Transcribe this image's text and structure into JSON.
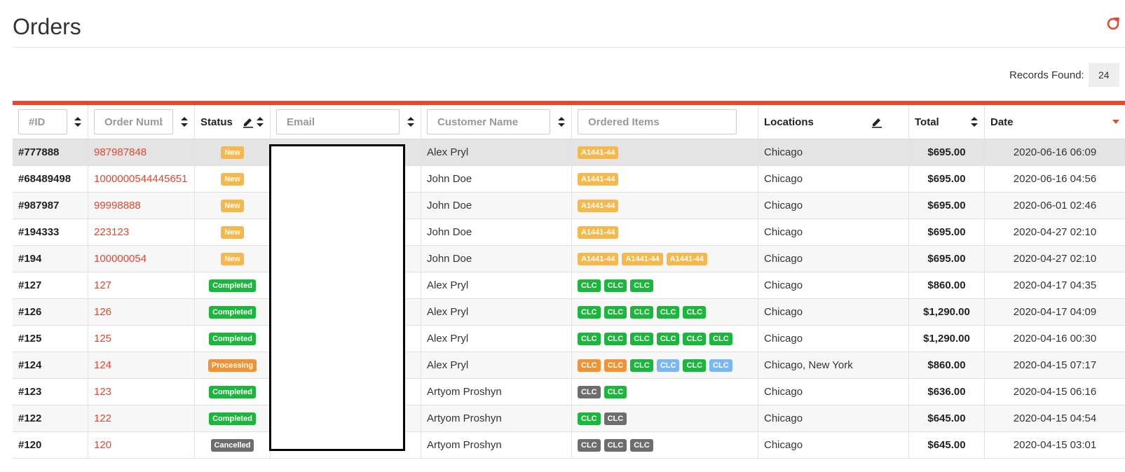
{
  "page": {
    "title": "Orders"
  },
  "toolbar": {
    "refresh_icon": "refresh-icon"
  },
  "records": {
    "label": "Records Found:",
    "count": "24"
  },
  "header": {
    "id_placeholder": "#ID",
    "order_number_placeholder": "Order Number",
    "status_label": "Status",
    "email_placeholder": "Email",
    "customer_name_placeholder": "Customer Name",
    "ordered_items_placeholder": "Ordered Items",
    "locations_label": "Locations",
    "total_label": "Total",
    "date_label": "Date"
  },
  "colors": {
    "accent": "#e5472f",
    "status_new": "#f7b84b",
    "status_completed": "#19b83a",
    "status_processing": "#f39232",
    "status_cancelled": "#6d6d6d",
    "item_blue": "#7ab8f5"
  },
  "orders": [
    {
      "id": "#777888",
      "number": "987987848",
      "status": "New",
      "status_class": "s-new",
      "customer": "Alex Pryl",
      "items": [
        {
          "label": "A1441-44",
          "color": "i-yellow"
        }
      ],
      "location": "Chicago",
      "total": "$695.00",
      "date": "2020-06-16 06:09",
      "selected": true
    },
    {
      "id": "#68489498",
      "number": "1000000544445651",
      "status": "New",
      "status_class": "s-new",
      "customer": "John Doe",
      "items": [
        {
          "label": "A1441-44",
          "color": "i-yellow"
        }
      ],
      "location": "Chicago",
      "total": "$695.00",
      "date": "2020-06-16 04:56"
    },
    {
      "id": "#987987",
      "number": "99998888",
      "status": "New",
      "status_class": "s-new",
      "customer": "John Doe",
      "items": [
        {
          "label": "A1441-44",
          "color": "i-yellow"
        }
      ],
      "location": "Chicago",
      "total": "$695.00",
      "date": "2020-06-01 02:46"
    },
    {
      "id": "#194333",
      "number": "223123",
      "status": "New",
      "status_class": "s-new",
      "customer": "John Doe",
      "items": [
        {
          "label": "A1441-44",
          "color": "i-yellow"
        }
      ],
      "location": "Chicago",
      "total": "$695.00",
      "date": "2020-04-27 02:10"
    },
    {
      "id": "#194",
      "number": "100000054",
      "status": "New",
      "status_class": "s-new",
      "customer": "John Doe",
      "items": [
        {
          "label": "A1441-44",
          "color": "i-yellow"
        },
        {
          "label": "A1441-44",
          "color": "i-yellow"
        },
        {
          "label": "A1441-44",
          "color": "i-yellow"
        }
      ],
      "location": "Chicago",
      "total": "$695.00",
      "date": "2020-04-27 02:10"
    },
    {
      "id": "#127",
      "number": "127",
      "status": "Completed",
      "status_class": "s-completed",
      "customer": "Alex Pryl",
      "items": [
        {
          "label": "CLC",
          "color": "i-green"
        },
        {
          "label": "CLC",
          "color": "i-green"
        },
        {
          "label": "CLC",
          "color": "i-green"
        }
      ],
      "location": "Chicago",
      "total": "$860.00",
      "date": "2020-04-17 04:35"
    },
    {
      "id": "#126",
      "number": "126",
      "status": "Completed",
      "status_class": "s-completed",
      "customer": "Alex Pryl",
      "items": [
        {
          "label": "CLC",
          "color": "i-green"
        },
        {
          "label": "CLC",
          "color": "i-green"
        },
        {
          "label": "CLC",
          "color": "i-green"
        },
        {
          "label": "CLC",
          "color": "i-green"
        },
        {
          "label": "CLC",
          "color": "i-green"
        }
      ],
      "location": "Chicago",
      "total": "$1,290.00",
      "date": "2020-04-17 04:09"
    },
    {
      "id": "#125",
      "number": "125",
      "status": "Completed",
      "status_class": "s-completed",
      "customer": "Alex Pryl",
      "items": [
        {
          "label": "CLC",
          "color": "i-green"
        },
        {
          "label": "CLC",
          "color": "i-green"
        },
        {
          "label": "CLC",
          "color": "i-green"
        },
        {
          "label": "CLC",
          "color": "i-green"
        },
        {
          "label": "CLC",
          "color": "i-green"
        },
        {
          "label": "CLC",
          "color": "i-green"
        }
      ],
      "location": "Chicago",
      "total": "$1,290.00",
      "date": "2020-04-16 00:30"
    },
    {
      "id": "#124",
      "number": "124",
      "status": "Processing",
      "status_class": "s-processing",
      "customer": "Alex Pryl",
      "items": [
        {
          "label": "CLC",
          "color": "i-orange"
        },
        {
          "label": "CLC",
          "color": "i-orange"
        },
        {
          "label": "CLC",
          "color": "i-green"
        },
        {
          "label": "CLC",
          "color": "i-blue"
        },
        {
          "label": "CLC",
          "color": "i-green"
        },
        {
          "label": "CLC",
          "color": "i-blue"
        }
      ],
      "location": "Chicago, New York",
      "total": "$860.00",
      "date": "2020-04-15 07:17"
    },
    {
      "id": "#123",
      "number": "123",
      "status": "Completed",
      "status_class": "s-completed",
      "customer": "Artyom Proshyn",
      "items": [
        {
          "label": "CLC",
          "color": "i-gray"
        },
        {
          "label": "CLC",
          "color": "i-green"
        }
      ],
      "location": "Chicago",
      "total": "$636.00",
      "date": "2020-04-15 06:16"
    },
    {
      "id": "#122",
      "number": "122",
      "status": "Completed",
      "status_class": "s-completed",
      "customer": "Artyom Proshyn",
      "items": [
        {
          "label": "CLC",
          "color": "i-green"
        },
        {
          "label": "CLC",
          "color": "i-gray"
        }
      ],
      "location": "Chicago",
      "total": "$645.00",
      "date": "2020-04-15 04:54"
    },
    {
      "id": "#120",
      "number": "120",
      "status": "Cancelled",
      "status_class": "s-cancelled",
      "customer": "Artyom Proshyn",
      "items": [
        {
          "label": "CLC",
          "color": "i-gray"
        },
        {
          "label": "CLC",
          "color": "i-gray"
        },
        {
          "label": "CLC",
          "color": "i-gray"
        }
      ],
      "location": "Chicago",
      "total": "$645.00",
      "date": "2020-04-15 03:01"
    }
  ]
}
